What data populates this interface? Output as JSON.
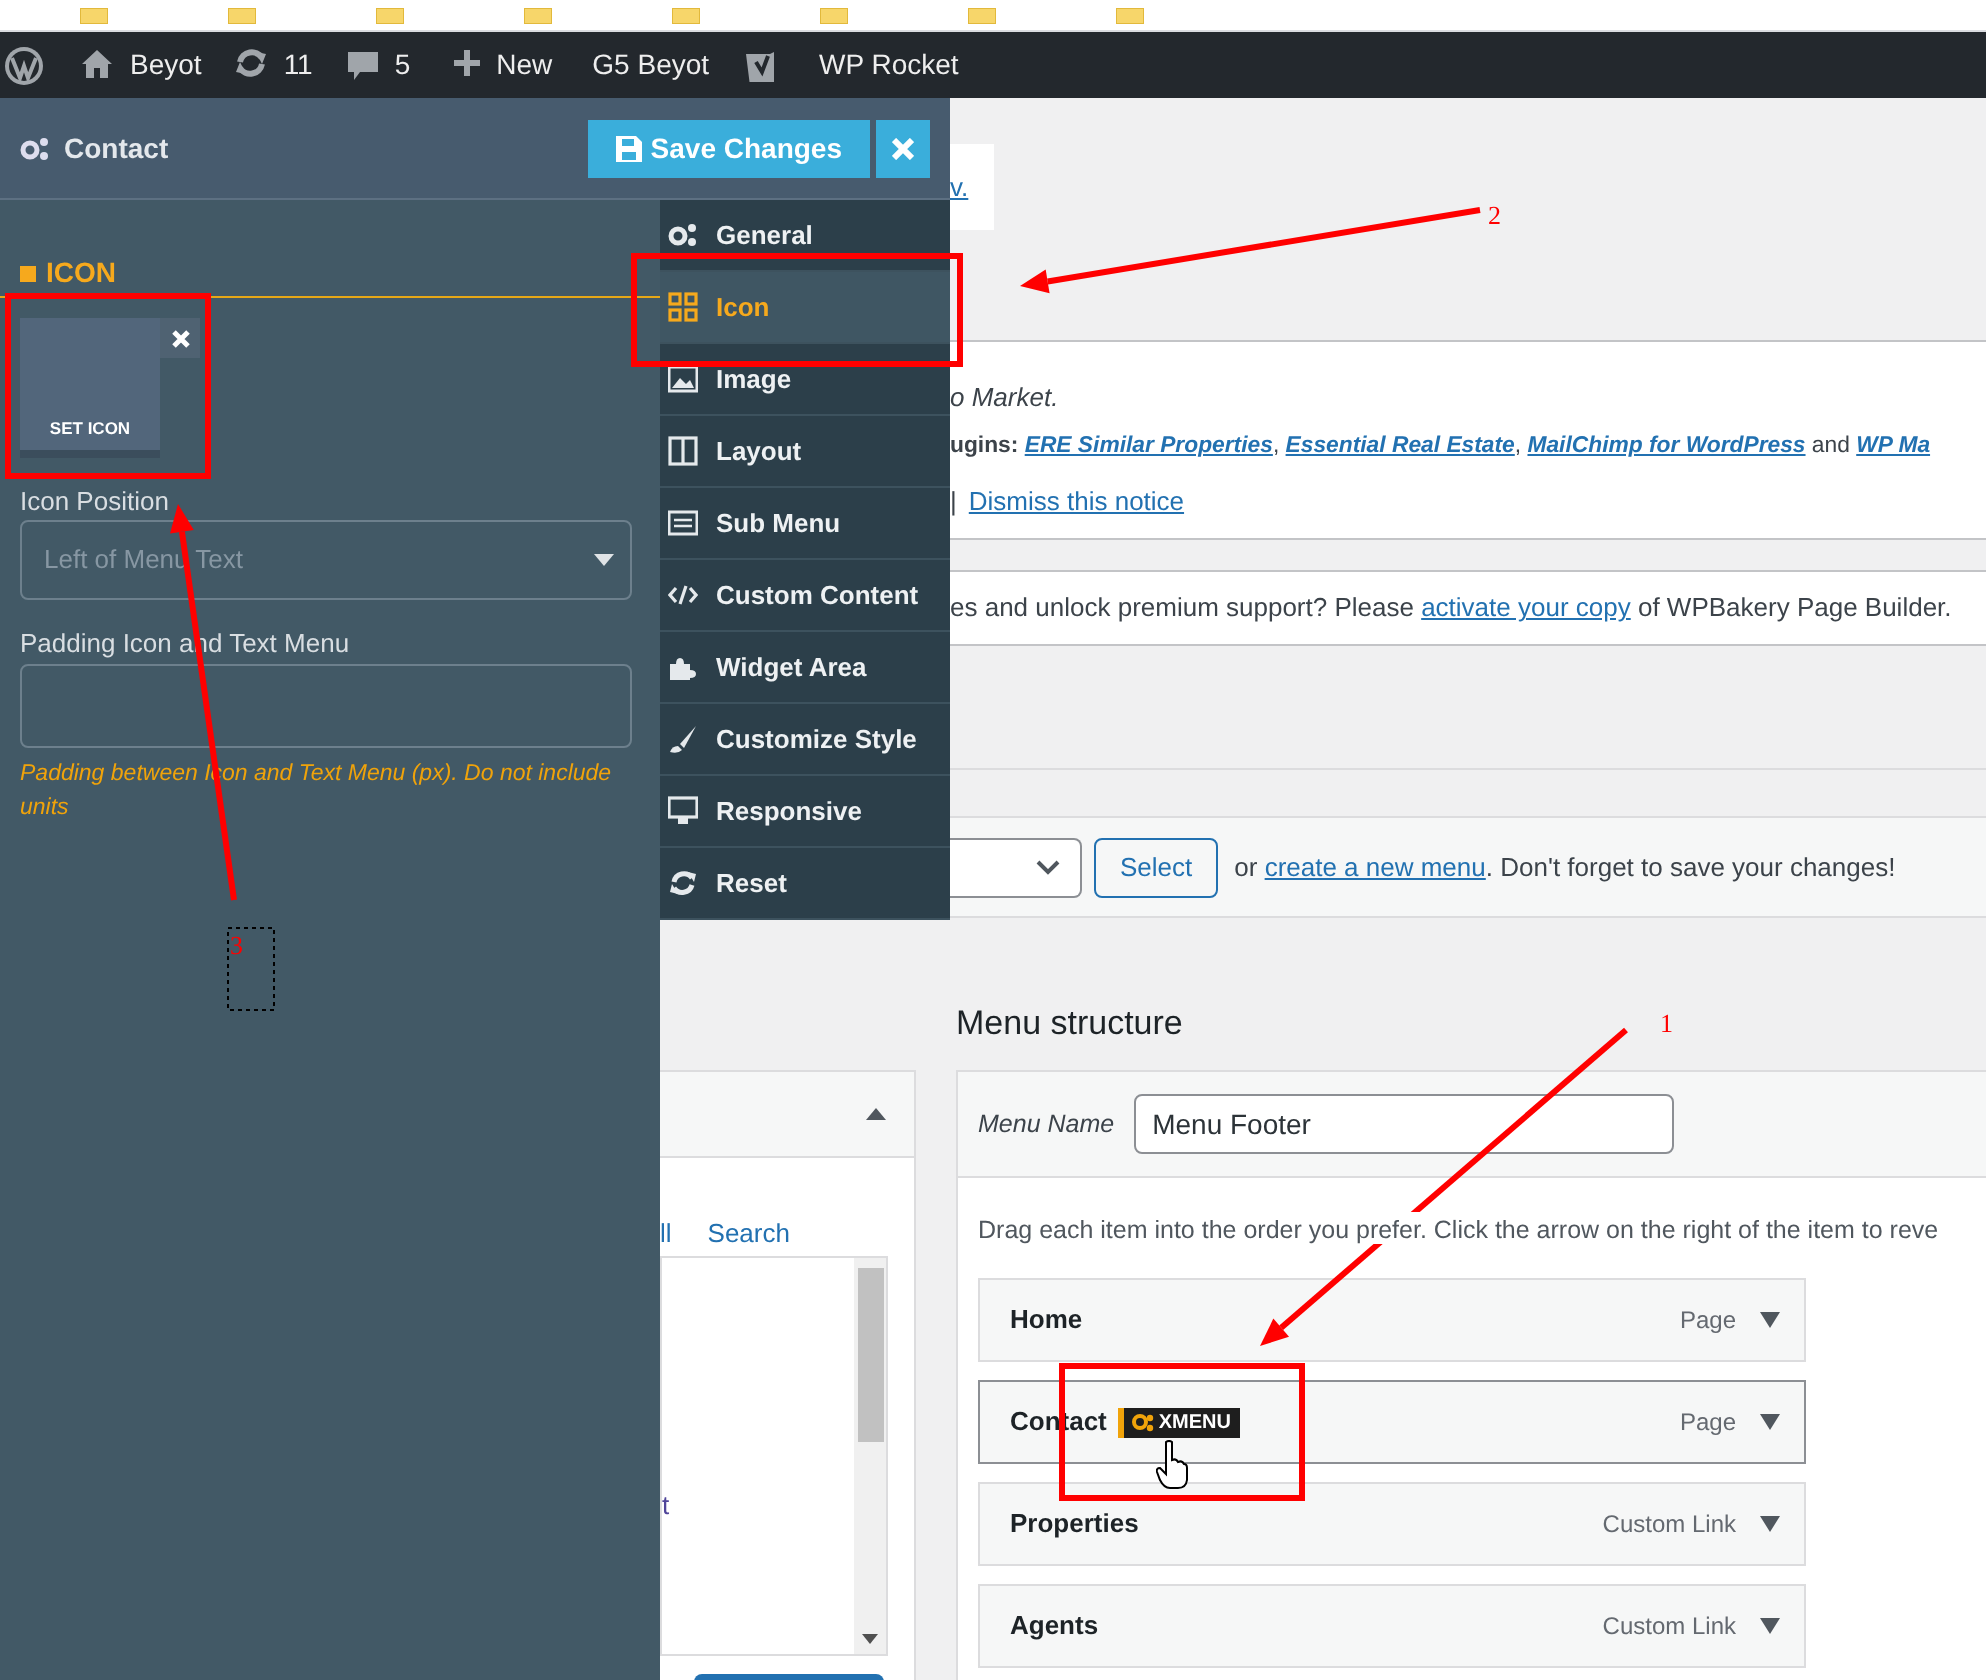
{
  "admin_bar": [
    {
      "kind": "logo"
    },
    {
      "kind": "home",
      "label": "Beyot"
    },
    {
      "kind": "updates",
      "label": "11"
    },
    {
      "kind": "comments",
      "label": "5"
    },
    {
      "kind": "new",
      "label": "New"
    },
    {
      "kind": "text",
      "label": "G5 Beyot"
    },
    {
      "kind": "seo"
    },
    {
      "kind": "text",
      "label": "WP Rocket"
    }
  ],
  "panel": {
    "title": "Contact",
    "save_button": "Save Changes",
    "section_heading": "ICON",
    "set_icon_label": "SET ICON",
    "fields": [
      {
        "kind": "select",
        "label": "Icon Position",
        "placeholder": "Left of Menu Text"
      },
      {
        "kind": "text",
        "label": "Padding Icon and Text Menu",
        "help": "Padding between Icon and Text Menu (px). Do not include units"
      }
    ],
    "tabs": [
      {
        "kind": "gears",
        "label": "General",
        "selected": false
      },
      {
        "kind": "grid",
        "label": "Icon",
        "selected": true
      },
      {
        "kind": "image",
        "label": "Image",
        "selected": false
      },
      {
        "kind": "columns",
        "label": "Layout",
        "selected": false
      },
      {
        "kind": "list",
        "label": "Sub Menu",
        "selected": false
      },
      {
        "kind": "code",
        "label": "Custom Content",
        "selected": false
      },
      {
        "kind": "puzzle",
        "label": "Widget Area",
        "selected": false
      },
      {
        "kind": "brush",
        "label": "Customize Style",
        "selected": false
      },
      {
        "kind": "monitor",
        "label": "Responsive",
        "selected": false
      },
      {
        "kind": "refresh",
        "label": "Reset",
        "selected": false
      }
    ]
  },
  "notices": {
    "first_link": "v.",
    "plugin_line_1": "o Market.",
    "plugin_line_2": [
      {
        "text": "ugins: ",
        "link": false
      },
      {
        "text": "ERE Similar Properties",
        "link": true
      },
      {
        "text": ", ",
        "link": false
      },
      {
        "text": "Essential Real Estate",
        "link": true
      },
      {
        "text": ", ",
        "link": false
      },
      {
        "text": "MailChimp for WordPress",
        "link": true
      },
      {
        "text": " and ",
        "link": false
      },
      {
        "text": "WP Ma",
        "link": true
      }
    ],
    "separator": "|",
    "dismiss_link": "Dismiss this notice",
    "license": [
      {
        "text": "es and unlock premium support? Please ",
        "link": false
      },
      {
        "text": "activate your copy",
        "link": true
      },
      {
        "text": " of WPBakery Page Builder.",
        "link": false
      }
    ]
  },
  "menu_select": {
    "button": "Select",
    "text": [
      {
        "text": "or ",
        "link": false
      },
      {
        "text": "create a new menu",
        "link": true
      },
      {
        "text": ". Don't forget to save your changes!",
        "link": false
      }
    ]
  },
  "add_items_box": {
    "tabs": [
      "ll",
      "Search"
    ],
    "list_text": "t"
  },
  "menu_structure": {
    "title": "Menu structure",
    "name_label": "Menu Name",
    "name_value": "Menu Footer",
    "instructions": "Drag each item into the order you prefer. Click the arrow on the right of the item to reve",
    "items": [
      {
        "label": "Home",
        "type": "Page",
        "hovered": false
      },
      {
        "label": "Contact",
        "type": "Page",
        "hovered": true,
        "badge": "XMENU"
      },
      {
        "label": "Properties",
        "type": "Custom Link",
        "hovered": false
      },
      {
        "label": "Agents",
        "type": "Custom Link",
        "hovered": false
      }
    ]
  },
  "annotations": [
    {
      "label": "1"
    },
    {
      "label": "2"
    },
    {
      "label": "3"
    }
  ]
}
